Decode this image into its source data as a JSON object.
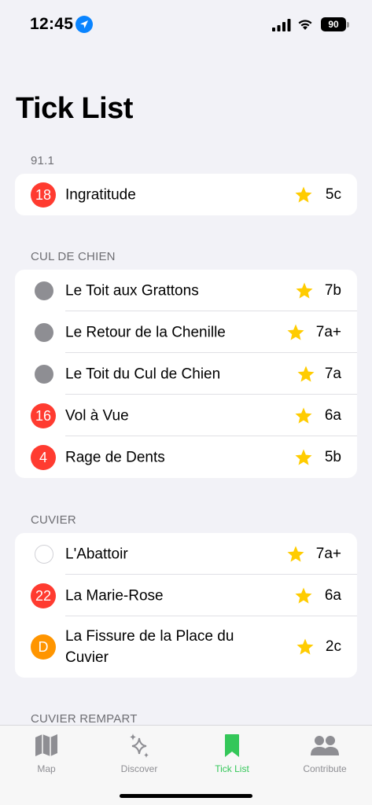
{
  "status_bar": {
    "time": "12:45",
    "battery": "90",
    "icons": [
      "location-arrow-icon",
      "cellular-signal-icon",
      "wifi-icon",
      "battery-icon"
    ]
  },
  "page_title": "Tick List",
  "colors": {
    "red": "#ff3b30",
    "gray": "#8e8e93",
    "orange": "#ff9500",
    "star": "#ffcc00",
    "green": "#34c759"
  },
  "sections": [
    {
      "header": "91.1",
      "routes": [
        {
          "badge": "18",
          "badge_style": "red",
          "name": "Ingratitude",
          "grade": "5c"
        }
      ]
    },
    {
      "header": "CUL DE CHIEN",
      "routes": [
        {
          "badge": "",
          "badge_style": "gray-dot",
          "name": "Le Toit aux Grattons",
          "grade": "7b"
        },
        {
          "badge": "",
          "badge_style": "gray-dot",
          "name": "Le Retour de la Chenille",
          "grade": "7a+"
        },
        {
          "badge": "",
          "badge_style": "gray-dot",
          "name": "Le Toit du Cul de Chien",
          "grade": "7a"
        },
        {
          "badge": "16",
          "badge_style": "red",
          "name": "Vol à Vue",
          "grade": "6a"
        },
        {
          "badge": "4",
          "badge_style": "red",
          "name": "Rage de Dents",
          "grade": "5b"
        }
      ]
    },
    {
      "header": "CUVIER",
      "routes": [
        {
          "badge": "",
          "badge_style": "outline",
          "name": "L'Abattoir",
          "grade": "7a+"
        },
        {
          "badge": "22",
          "badge_style": "red",
          "name": "La Marie-Rose",
          "grade": "6a"
        },
        {
          "badge": "D",
          "badge_style": "orange",
          "name": "La Fissure de la Place du Cuvier",
          "grade": "2c"
        }
      ]
    },
    {
      "header": "CUVIER REMPART",
      "routes": []
    }
  ],
  "tabs": [
    {
      "label": "Map",
      "icon": "map-icon",
      "active": false
    },
    {
      "label": "Discover",
      "icon": "sparkles-icon",
      "active": false
    },
    {
      "label": "Tick List",
      "icon": "bookmark-icon",
      "active": true
    },
    {
      "label": "Contribute",
      "icon": "people-icon",
      "active": false
    }
  ]
}
